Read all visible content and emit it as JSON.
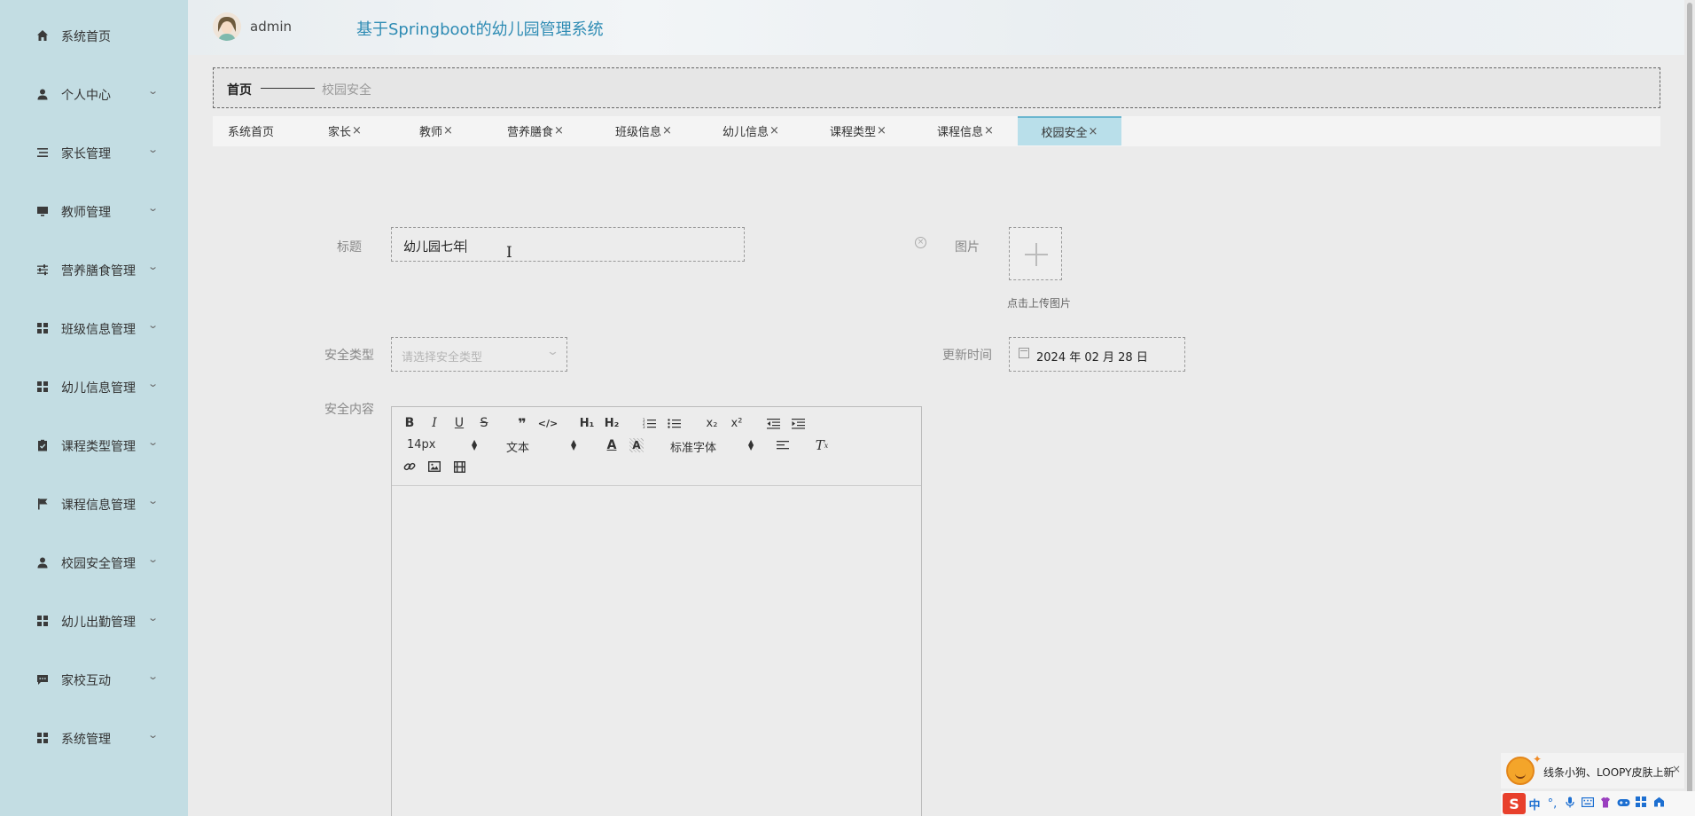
{
  "sidebar": {
    "items": [
      {
        "label": "系统首页",
        "icon": "home-icon",
        "has_children": false
      },
      {
        "label": "个人中心",
        "icon": "user-icon",
        "has_children": true
      },
      {
        "label": "家长管理",
        "icon": "list-icon",
        "has_children": true
      },
      {
        "label": "教师管理",
        "icon": "monitor-icon",
        "has_children": true
      },
      {
        "label": "营养膳食管理",
        "icon": "sliders-icon",
        "has_children": true
      },
      {
        "label": "班级信息管理",
        "icon": "grid-icon",
        "has_children": true
      },
      {
        "label": "幼儿信息管理",
        "icon": "grid-icon",
        "has_children": true
      },
      {
        "label": "课程类型管理",
        "icon": "clipboard-icon",
        "has_children": true
      },
      {
        "label": "课程信息管理",
        "icon": "flag-icon",
        "has_children": true
      },
      {
        "label": "校园安全管理",
        "icon": "user-icon",
        "has_children": true
      },
      {
        "label": "幼儿出勤管理",
        "icon": "grid-icon",
        "has_children": true
      },
      {
        "label": "家校互动",
        "icon": "chat-icon",
        "has_children": true
      },
      {
        "label": "系统管理",
        "icon": "grid-icon",
        "has_children": true
      }
    ]
  },
  "header": {
    "username": "admin",
    "title": "基于Springboot的幼儿园管理系统"
  },
  "breadcrumb": {
    "home": "首页",
    "current": "校园安全"
  },
  "tabs": [
    {
      "label": "系统首页",
      "closable": false,
      "active": false
    },
    {
      "label": "家长",
      "closable": true,
      "active": false
    },
    {
      "label": "教师",
      "closable": true,
      "active": false
    },
    {
      "label": "营养膳食",
      "closable": true,
      "active": false
    },
    {
      "label": "班级信息",
      "closable": true,
      "active": false
    },
    {
      "label": "幼儿信息",
      "closable": true,
      "active": false
    },
    {
      "label": "课程类型",
      "closable": true,
      "active": false
    },
    {
      "label": "课程信息",
      "closable": true,
      "active": false
    },
    {
      "label": "校园安全",
      "closable": true,
      "active": true
    }
  ],
  "tab_close_glyph": "×",
  "form": {
    "title_label": "标题",
    "title_value": "幼儿园七年",
    "image_label": "图片",
    "upload_hint": "点击上传图片",
    "type_label": "安全类型",
    "type_placeholder": "请选择安全类型",
    "time_label": "更新时间",
    "time_value": "2024 年 02 月 28 日",
    "content_label": "安全内容"
  },
  "editor": {
    "font_size": "14px",
    "block_format": "文本",
    "font_family": "标准字体"
  },
  "ime": {
    "notice": "线条小狗、LOOPY皮肤上新",
    "close": "×",
    "logo": "S",
    "mode": "中"
  },
  "colors": {
    "sidebar_bg": "#c3dde3",
    "title_accent": "#2f8cb4",
    "active_tab_bg": "#b9dfea"
  }
}
